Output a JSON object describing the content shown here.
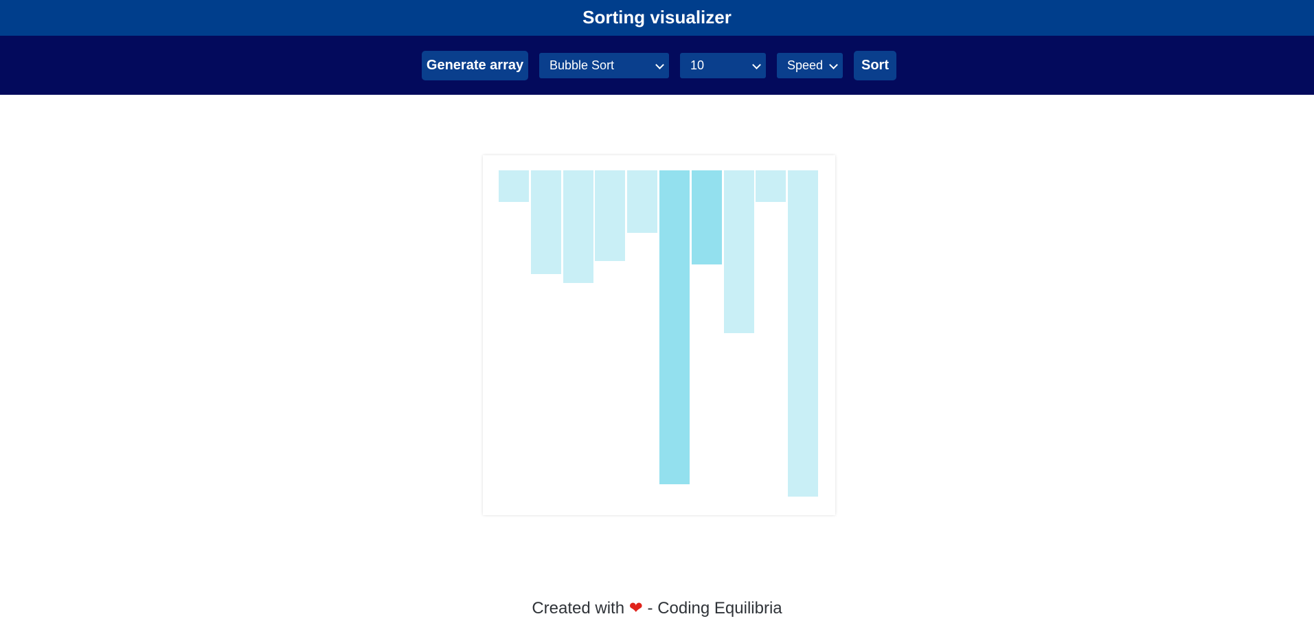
{
  "app": {
    "title": "Sorting visualizer"
  },
  "toolbar": {
    "generate_label": "Generate array",
    "algorithm_value": "Bubble Sort",
    "size_value": "10",
    "speed_value": "Speed",
    "sort_label": "Sort"
  },
  "chart_data": {
    "type": "bar",
    "orientation": "downward",
    "values": [
      10,
      33,
      36,
      29,
      20,
      100,
      30,
      52,
      10,
      104
    ],
    "highlighted_indices": [
      5,
      6
    ],
    "colors": {
      "default": "#c9eff6",
      "highlighted": "#93e0ee"
    }
  },
  "footer": {
    "prefix": "Created with",
    "heart_icon": "heart-icon",
    "suffix": "- Coding Equilibria"
  }
}
